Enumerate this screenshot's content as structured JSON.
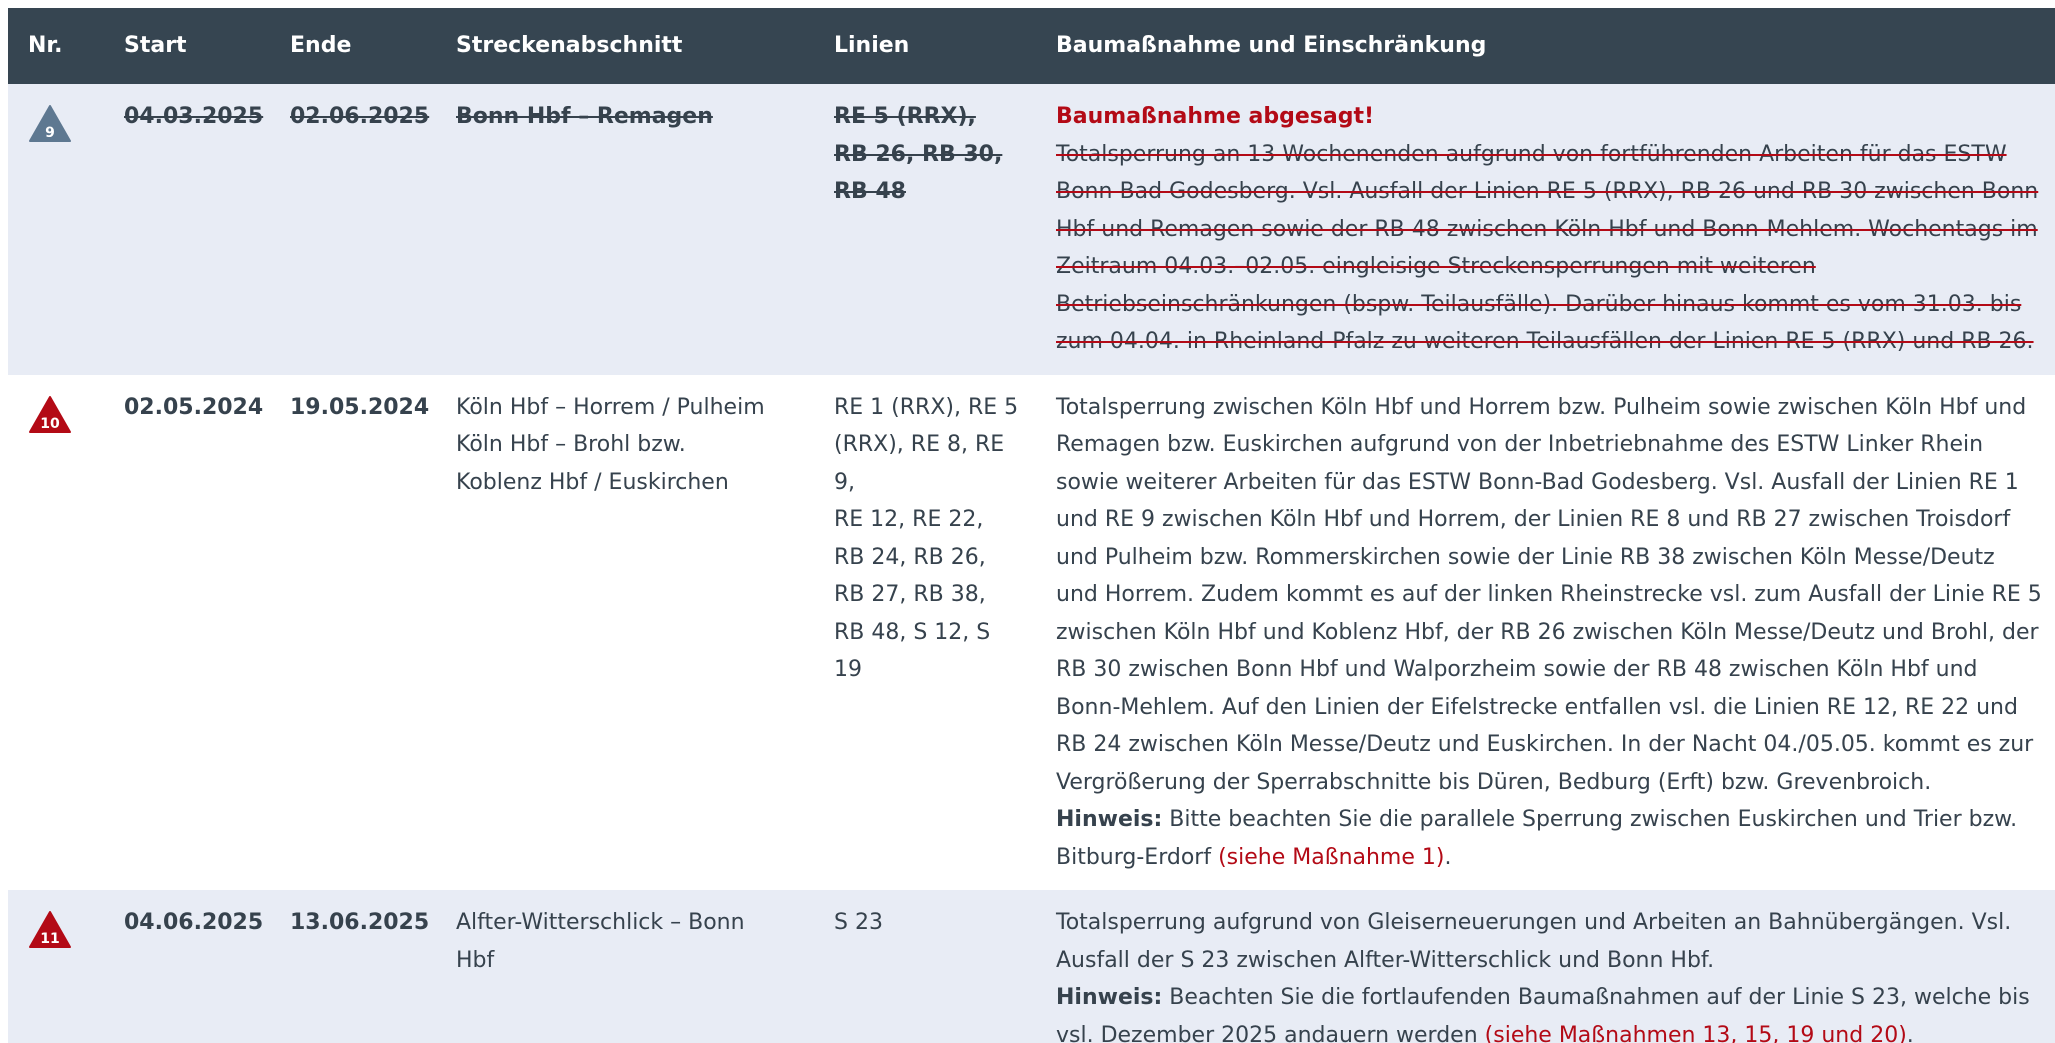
{
  "header": {
    "nr": "Nr.",
    "start": "Start",
    "end": "Ende",
    "section": "Streckenabschnitt",
    "lines": "Linien",
    "measure": "Baumaßnahme und Einschränkung"
  },
  "colors": {
    "header_bg": "#364551",
    "row_grey": "#e8ecf5",
    "accent_red": "#b30a16",
    "triangle_grey": "#5e7891",
    "triangle_red": "#b30a16"
  },
  "rows": [
    {
      "nr": "9",
      "icon": "warning-triangle-grey-icon",
      "start": "04.03.2025",
      "end": "02.06.2025",
      "section": "Bonn Hbf – Remagen",
      "lines": [
        "RE 5 (RRX),",
        "RB 26, RB 30,",
        "RB 48"
      ],
      "cancelled_label": "Baumaßnahme abgesagt!",
      "description": "Totalsperrung an 13 Wochenenden aufgrund von fortführenden Arbeiten für das ESTW Bonn-Bad Godesberg. Vsl. Ausfall der Linien RE 5 (RRX), RB 26 und RB 30 zwischen Bonn Hbf und Remagen sowie der RB 48 zwischen Köln Hbf und Bonn-Mehlem. Wochentags im Zeitraum 04.03.–02.05. eingleisige Streckensperrungen mit weiteren Betriebseinschränkungen (bspw. Teilausfälle). Darüber hinaus kommt es vom 31.03. bis zum 04.04. in Rheinland-Pfalz zu weiteren Teilausfällen der Linien RE 5 (RRX) und RB 26."
    },
    {
      "nr": "10",
      "icon": "warning-triangle-red-icon",
      "start": "02.05.2024",
      "end": "19.05.2024",
      "section_lines": [
        "Köln Hbf – Horrem / Pulheim",
        "Köln Hbf – Brohl bzw. Koblenz Hbf / Euskirchen"
      ],
      "lines": [
        "RE 1 (RRX), RE 5",
        "(RRX), RE 8, RE 9,",
        "RE 12, RE 22,",
        "RB 24, RB 26,",
        "RB 27, RB 38,",
        "RB 48, S 12, S 19"
      ],
      "description": "Totalsperrung zwischen Köln Hbf und Horrem bzw. Pulheim sowie zwischen Köln Hbf und Remagen bzw. Euskirchen aufgrund von der Inbetriebnahme des ESTW Linker Rhein sowie weiterer Arbeiten für das ESTW Bonn-Bad Godesberg. Vsl. Ausfall der Linien RE 1 und RE 9 zwischen Köln Hbf und Horrem, der Linien RE 8 und RB 27 zwischen Troisdorf und Pulheim bzw. Rommerskirchen sowie der Linie RB 38 zwischen Köln Messe/Deutz und Horrem. Zudem kommt es auf der linken Rheinstrecke vsl. zum Ausfall der Linie RE 5 zwischen Köln Hbf und Koblenz Hbf, der RB 26 zwischen Köln Messe/Deutz und Brohl, der RB 30 zwischen Bonn Hbf und Walporzheim sowie der RB 48 zwischen Köln Hbf und Bonn-Mehlem.  Auf den Linien der Eifelstrecke entfallen vsl. die Linien RE 12, RE 22 und RB 24 zwischen Köln Messe/Deutz und Euskirchen. In der Nacht 04./05.05. kommt es zur Vergrößerung der Sperrabschnitte bis Düren, Bedburg (Erft) bzw. Grevenbroich.",
      "hint_label": "Hinweis:",
      "hint_text": " Bitte beachten Sie die parallele Sperrung zwischen Euskirchen und Trier bzw. Bitburg-Erdorf ",
      "hint_ref": "(siehe Maßnahme 1)",
      "hint_end": "."
    },
    {
      "nr": "11",
      "icon": "warning-triangle-red-icon",
      "start": "04.06.2025",
      "end": "13.06.2025",
      "section": "Alfter-Witterschlick – Bonn Hbf",
      "lines": [
        "S 23"
      ],
      "description": "Totalsperrung aufgrund von Gleiserneuerungen und Arbeiten an Bahnübergängen. Vsl. Ausfall der S 23 zwischen Alfter-Witterschlick und Bonn Hbf.",
      "hint_label": "Hinweis:",
      "hint_text": " Beachten Sie die fortlaufenden Baumaßnahmen auf der Linie S 23, welche bis vsl. Dezember 2025 andauern werden ",
      "hint_ref": "(siehe Maßnahmen 13, 15, 19 und 20)",
      "hint_end": "."
    }
  ]
}
